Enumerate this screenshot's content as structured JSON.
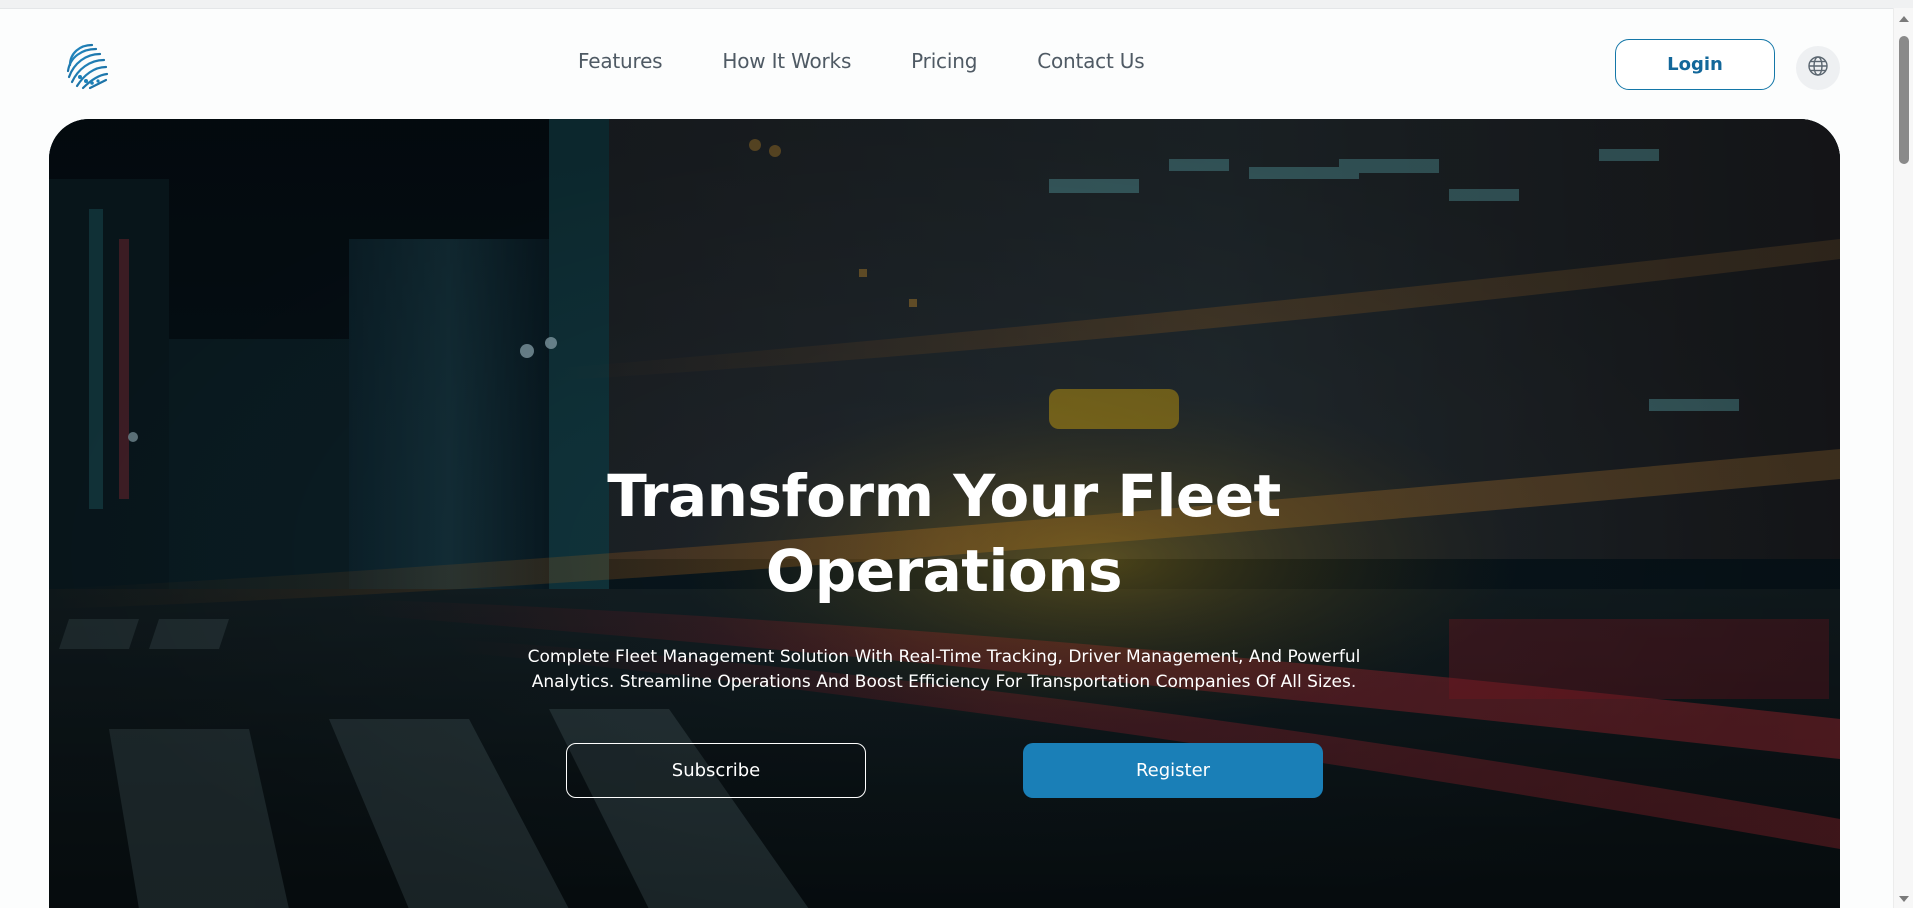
{
  "nav": {
    "items": [
      {
        "label": "Features"
      },
      {
        "label": "How It Works"
      },
      {
        "label": "Pricing"
      },
      {
        "label": "Contact Us"
      }
    ],
    "login_label": "Login",
    "language_icon": "globe-icon"
  },
  "hero": {
    "title_line1": "Transform Your Fleet",
    "title_line2": "Operations",
    "subtitle_line1": "Complete Fleet Management Solution With Real-Time Tracking, Driver Management, And Powerful",
    "subtitle_line2": "Analytics. Streamline Operations And Boost Efficiency For Transportation Companies Of All Sizes.",
    "subscribe_label": "Subscribe",
    "register_label": "Register"
  },
  "colors": {
    "accent": "#1a7fb7",
    "login_text": "#12679a",
    "nav_text": "#4f5a64"
  }
}
